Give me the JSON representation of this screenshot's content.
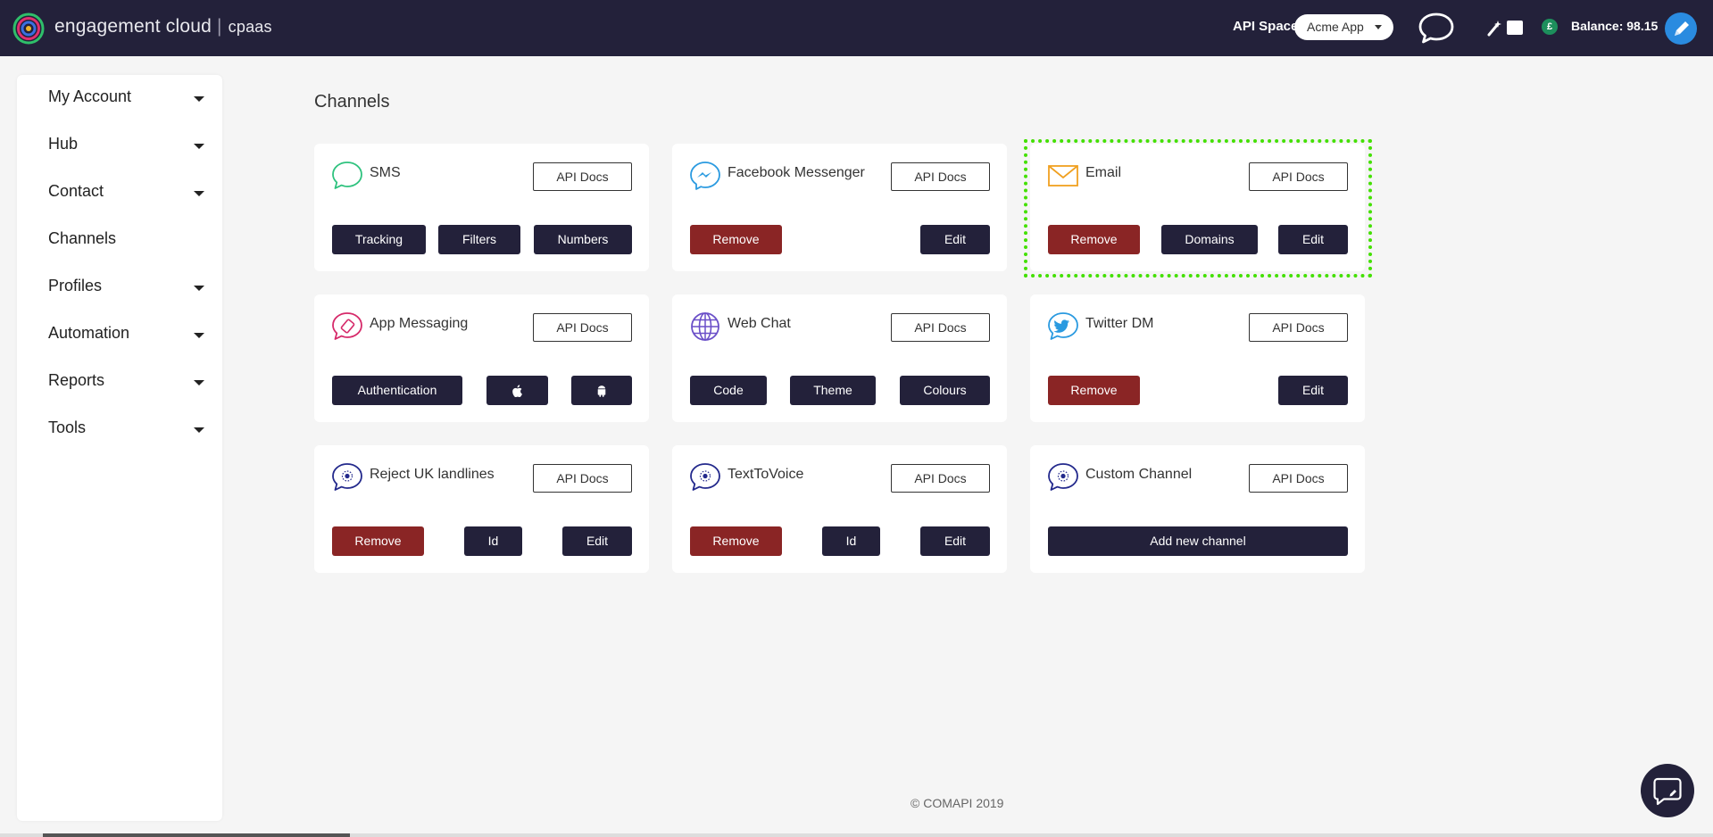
{
  "header": {
    "brand_name": "engagement cloud",
    "brand_sep": "|",
    "brand_product": "cpaas",
    "api_space_label": "API Space:",
    "api_space_value": "Acme App",
    "currency_symbol": "£",
    "balance_text": "Balance: 98.15"
  },
  "sidebar": {
    "items": [
      {
        "label": "My Account",
        "has_dropdown": true
      },
      {
        "label": "Hub",
        "has_dropdown": true
      },
      {
        "label": "Contact",
        "has_dropdown": true
      },
      {
        "label": "Channels",
        "has_dropdown": false
      },
      {
        "label": "Profiles",
        "has_dropdown": true
      },
      {
        "label": "Automation",
        "has_dropdown": true
      },
      {
        "label": "Reports",
        "has_dropdown": true
      },
      {
        "label": "Tools",
        "has_dropdown": true
      }
    ]
  },
  "main": {
    "title": "Channels",
    "api_docs_label": "API Docs",
    "cards": [
      {
        "title": "SMS",
        "icon": "sms-icon",
        "buttons": [
          "Tracking",
          "Filters",
          "Numbers"
        ]
      },
      {
        "title": "Facebook Messenger",
        "icon": "facebook-messenger-icon",
        "buttons": [
          "Remove",
          "Edit"
        ]
      },
      {
        "title": "Email",
        "icon": "email-icon",
        "buttons": [
          "Remove",
          "Domains",
          "Edit"
        ]
      },
      {
        "title": "App Messaging",
        "icon": "app-messaging-icon",
        "buttons": [
          "Authentication",
          "apple-icon",
          "android-icon"
        ]
      },
      {
        "title": "Web Chat",
        "icon": "globe-icon",
        "buttons": [
          "Code",
          "Theme",
          "Colours"
        ]
      },
      {
        "title": "Twitter DM",
        "icon": "twitter-icon",
        "buttons": [
          "Remove",
          "Edit"
        ]
      },
      {
        "title": "Reject UK landlines",
        "icon": "custom-channel-icon",
        "buttons": [
          "Remove",
          "Id",
          "Edit"
        ]
      },
      {
        "title": "TextToVoice",
        "icon": "custom-channel-icon",
        "buttons": [
          "Remove",
          "Id",
          "Edit"
        ]
      },
      {
        "title": "Custom Channel",
        "icon": "custom-channel-icon",
        "buttons": [
          "Add new channel"
        ]
      }
    ]
  },
  "footer": {
    "copyright": "© COMAPI 2019"
  },
  "colors": {
    "topbar": "#23213a",
    "button_dark": "#23213a",
    "button_remove": "#8a2525",
    "highlight": "#43e000",
    "background": "#f5f5f5"
  }
}
